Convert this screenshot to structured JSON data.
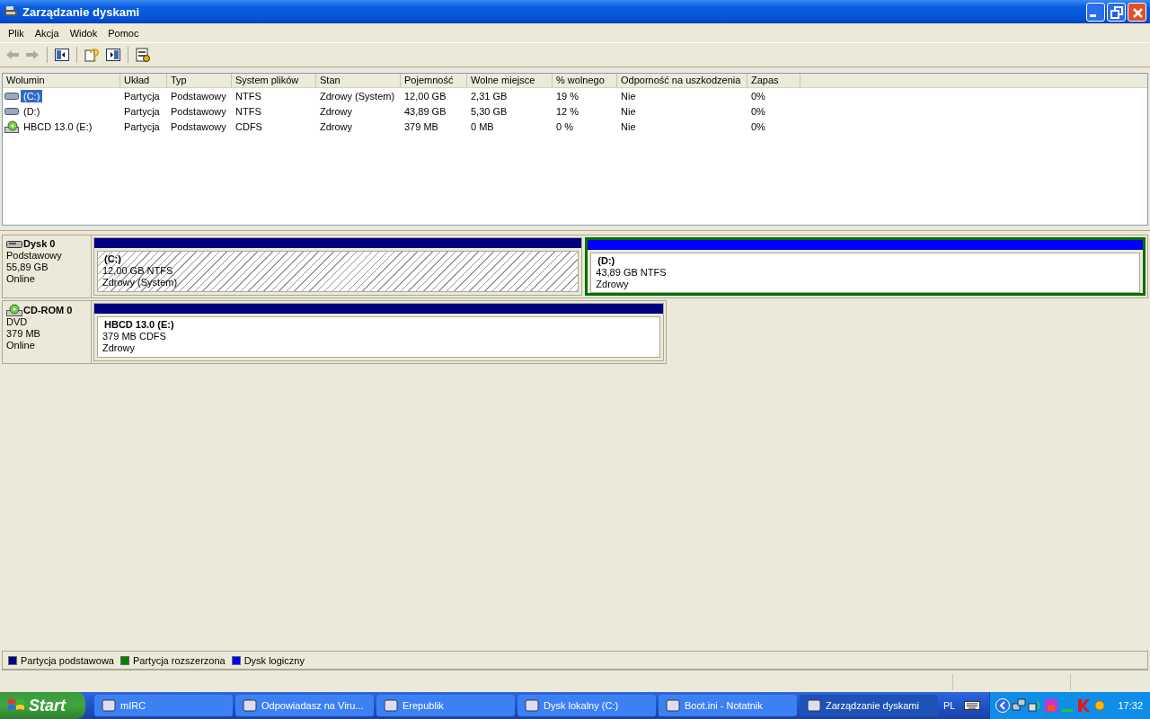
{
  "window": {
    "title": "Zarządzanie dyskami"
  },
  "menu": [
    "Plik",
    "Akcja",
    "Widok",
    "Pomoc"
  ],
  "table": {
    "columns": [
      "Wolumin",
      "Układ",
      "Typ",
      "System plików",
      "Stan",
      "Pojemność",
      "Wolne miejsce",
      "% wolnego",
      "Odporność na uszkodzenia",
      "Zapas"
    ],
    "rows": [
      {
        "kind": "hdd",
        "selected": true,
        "cells": [
          "(C:)",
          "Partycja",
          "Podstawowy",
          "NTFS",
          "Zdrowy (System)",
          "12,00 GB",
          "2,31 GB",
          "19 %",
          "Nie",
          "0%"
        ]
      },
      {
        "kind": "hdd",
        "selected": false,
        "cells": [
          "(D:)",
          "Partycja",
          "Podstawowy",
          "NTFS",
          "Zdrowy",
          "43,89 GB",
          "5,30 GB",
          "12 %",
          "Nie",
          "0%"
        ]
      },
      {
        "kind": "cd",
        "selected": false,
        "cells": [
          "HBCD 13.0 (E:)",
          "Partycja",
          "Podstawowy",
          "CDFS",
          "Zdrowy",
          "379 MB",
          "0 MB",
          "0 %",
          "Nie",
          "0%"
        ]
      }
    ]
  },
  "disks": [
    {
      "kind": "hdd",
      "name": "Dysk 0",
      "type": "Podstawowy",
      "size": "55,89 GB",
      "status": "Online",
      "partitions": [
        {
          "kind": "primary",
          "selected": true,
          "name": "(C:)",
          "size": "12,00 GB NTFS",
          "status": "Zdrowy (System)"
        },
        {
          "kind": "logical",
          "selected": false,
          "name": "(D:)",
          "size": "43,89 GB NTFS",
          "status": "Zdrowy"
        }
      ]
    },
    {
      "kind": "cd",
      "name": "CD-ROM 0",
      "type": "DVD",
      "size": "379 MB",
      "status": "Online",
      "partitions": [
        {
          "kind": "primary",
          "selected": false,
          "name": "HBCD 13.0  (E:)",
          "size": "379 MB CDFS",
          "status": "Zdrowy"
        }
      ]
    }
  ],
  "legend": [
    {
      "label": "Partycja podstawowa",
      "color": "#000080"
    },
    {
      "label": "Partycja rozszerzona",
      "color": "#008000"
    },
    {
      "label": "Dysk logiczny",
      "color": "#0000ff"
    }
  ],
  "taskbar": {
    "start": "Start",
    "tasks": [
      {
        "label": "mIRC",
        "selected": false
      },
      {
        "label": "Odpowiadasz na Viru...",
        "selected": false
      },
      {
        "label": "Erepublik",
        "selected": false
      },
      {
        "label": "Dysk lokalny (C:)",
        "selected": false
      },
      {
        "label": "Boot.ini - Notatnik",
        "selected": false
      },
      {
        "label": "Zarządzanie dyskami",
        "selected": true
      }
    ],
    "language": "PL",
    "clock": "17:32"
  }
}
